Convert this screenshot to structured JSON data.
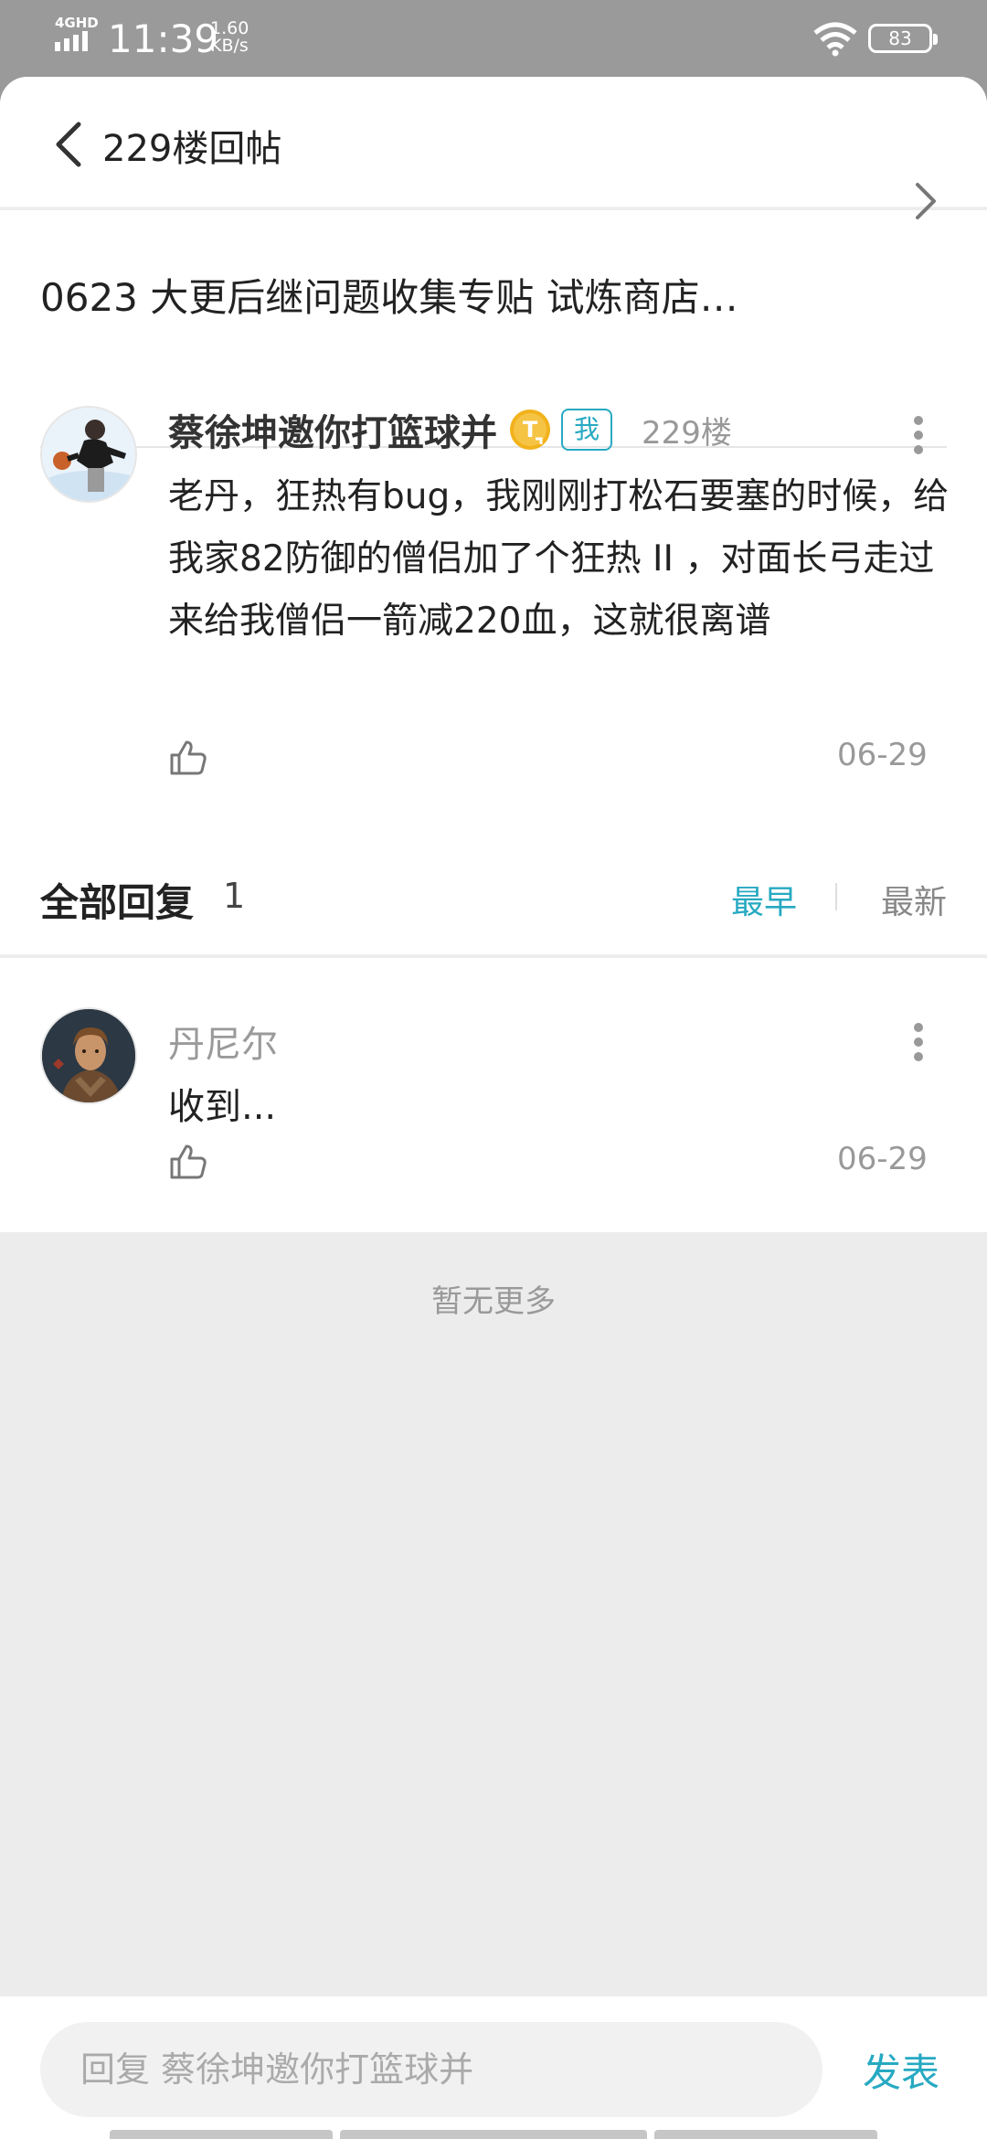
{
  "status_bar": {
    "network": "4GHD",
    "time": "11:39",
    "speed_value": "1.60",
    "speed_unit": "KB/s",
    "battery": "83"
  },
  "header": {
    "title": "229楼回帖"
  },
  "thread": {
    "title": "0623 大更后继问题收集专贴 试炼商店…"
  },
  "post": {
    "author": "蔡徐坤邀你打篮球并",
    "level_badge_letter": "T",
    "me_tag": "我",
    "floor": "229楼",
    "body": "老丹，狂热有bug，我刚刚打松石要塞的时候，给我家82防御的僧侣加了个狂热 II ，对面长弓走过来给我僧侣一箭减220血，这就很离谱",
    "date": "06-29"
  },
  "replies": {
    "title": "全部回复",
    "count": "1",
    "sort_earliest": "最早",
    "sort_newest": "最新",
    "items": [
      {
        "author": "丹尼尔",
        "body": "收到...",
        "date": "06-29"
      }
    ],
    "no_more": "暂无更多"
  },
  "reply_bar": {
    "placeholder": "回复 蔡徐坤邀你打篮球并",
    "send_label": "发表"
  },
  "colors": {
    "accent": "#27a9c2",
    "status_bar_bg": "#9a9a9a",
    "page_bg": "#ececec",
    "badge_gold": "#f2b21c"
  }
}
